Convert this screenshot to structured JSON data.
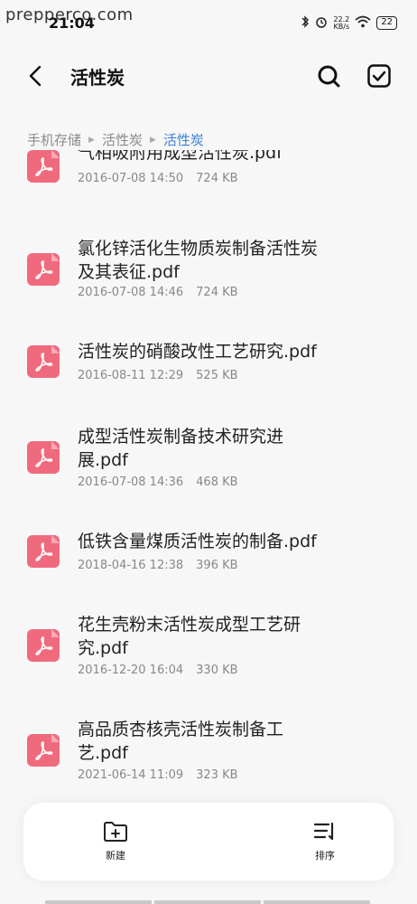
{
  "status_bar": {
    "watermark": "prepperco.com",
    "time": "21:04",
    "net_speed_value": "22.2",
    "net_speed_unit": "KB/s",
    "battery": "22"
  },
  "header": {
    "title": "活性炭"
  },
  "breadcrumb": {
    "items": [
      "手机存储",
      "活性炭",
      "活性炭"
    ]
  },
  "files": [
    {
      "name": "气相吸附用成型活性炭.pdf",
      "date": "2016-07-08 14:50",
      "size": "724 KB"
    },
    {
      "name": "氯化锌活化生物质炭制备活性炭及其表征.pdf",
      "date": "2016-07-08 14:46",
      "size": "724 KB"
    },
    {
      "name": "活性炭的硝酸改性工艺研究.pdf",
      "date": "2016-08-11 12:29",
      "size": "525 KB"
    },
    {
      "name": "成型活性炭制备技术研究进展.pdf",
      "date": "2016-07-08 14:36",
      "size": "468 KB"
    },
    {
      "name": "低铁含量煤质活性炭的制备.pdf",
      "date": "2018-04-16 12:38",
      "size": "396 KB"
    },
    {
      "name": "花生壳粉末活性炭成型工艺研究.pdf",
      "date": "2016-12-20 16:04",
      "size": "330 KB"
    },
    {
      "name": "高品质杏核壳活性炭制备工艺.pdf",
      "date": "2021-06-14 11:09",
      "size": "323 KB"
    }
  ],
  "toolbar": {
    "new_label": "新建",
    "sort_label": "排序"
  },
  "colors": {
    "pdf_icon": "#f06a7e",
    "breadcrumb_active": "#3b82d6"
  }
}
